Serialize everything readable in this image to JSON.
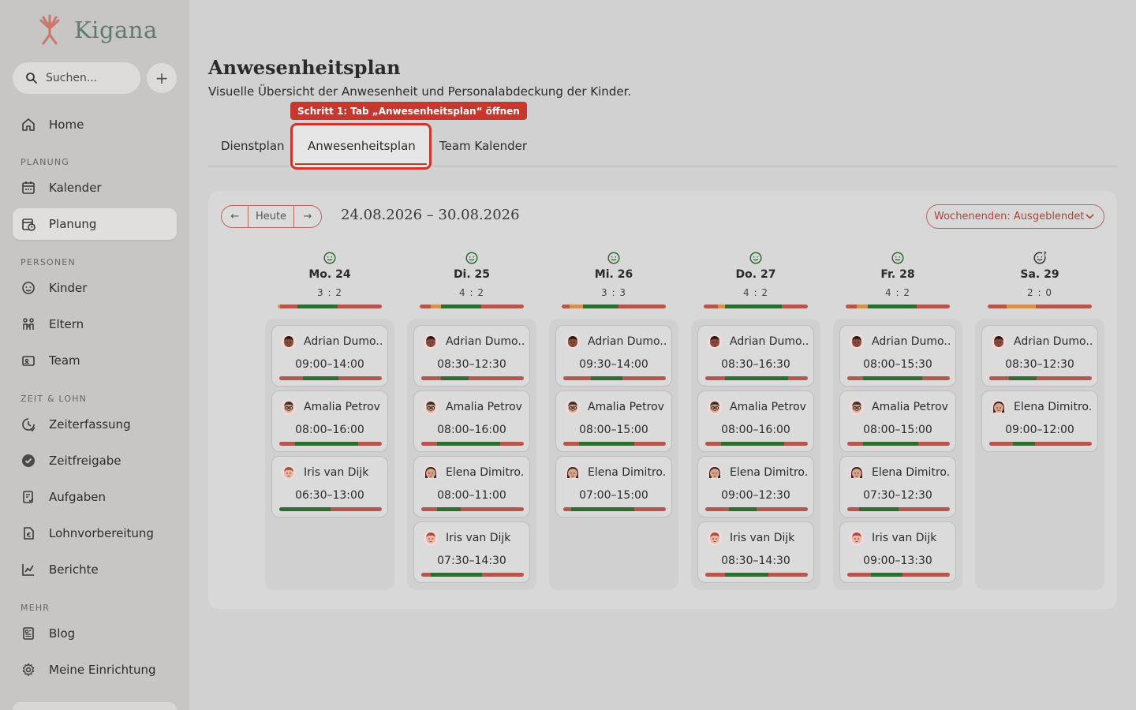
{
  "app": {
    "logo_text": "Kigana"
  },
  "search": {
    "placeholder": "Suchen..."
  },
  "sidebar": {
    "add_label": "+",
    "home": "Home",
    "sections": {
      "planung": "PLANUNG",
      "personen": "PERSONEN",
      "zeit": "ZEIT & LOHN",
      "mehr": "MEHR"
    },
    "items": {
      "kalender": "Kalender",
      "planung": "Planung",
      "kinder": "Kinder",
      "eltern": "Eltern",
      "team": "Team",
      "zeiterfassung": "Zeiterfassung",
      "zeitfreigabe": "Zeitfreigabe",
      "aufgaben": "Aufgaben",
      "lohnvorbereitung": "Lohnvorbereitung",
      "berichte": "Berichte",
      "blog": "Blog",
      "einrichtung": "Meine Einrichtung"
    },
    "active_item": "Planung"
  },
  "page": {
    "title": "Anwesenheitsplan",
    "subtitle": "Visuelle Übersicht der Anwesenheit und Personalabdeckung der Kinder.",
    "tooltip": "Schritt 1: Tab „Anwesenheitsplan“ öffnen",
    "tabs": [
      "Dienstplan",
      "Anwesenheitsplan",
      "Team Kalender"
    ],
    "active_tab": "Anwesenheitsplan"
  },
  "toolbar": {
    "prev": "←",
    "today": "Heute",
    "next": "→",
    "date_range": "24.08.2026 – 30.08.2026",
    "weekend_toggle": "Wochenenden: Ausgeblendet"
  },
  "colors": {
    "accent": "#a9453b",
    "good": "#2f6b32",
    "warn": "#d19455",
    "bad": "#b5574c"
  },
  "days": [
    {
      "name": "Mo. 24",
      "ratio": "3 : 2",
      "icon": "smile-icon",
      "bar": [
        [
          "o",
          3
        ],
        [
          "r",
          22
        ],
        [
          "g",
          51
        ],
        [
          "r",
          56
        ]
      ],
      "cards": [
        {
          "name": "Adrian Dumo...",
          "time": "09:00–14:00",
          "avatar": "boy-avatar",
          "bar": [
            [
              "r",
              30
            ],
            [
              "g",
              45
            ],
            [
              "r",
              55
            ]
          ]
        },
        {
          "name": "Amalia Petrov",
          "time": "08:00–16:00",
          "avatar": "glasses-avatar",
          "bar": [
            [
              "r",
              20
            ],
            [
              "g",
              80
            ],
            [
              "r",
              30
            ]
          ]
        },
        {
          "name": "Iris van Dijk",
          "time": "06:30–13:00",
          "avatar": "girl-avatar",
          "bar": [
            [
              "g",
              65
            ],
            [
              "r",
              65
            ]
          ]
        }
      ]
    },
    {
      "name": "Di. 25",
      "ratio": "4 : 2",
      "icon": "smile-icon",
      "bar": [
        [
          "r",
          14
        ],
        [
          "o",
          13
        ],
        [
          "g",
          51
        ],
        [
          "r",
          54
        ]
      ],
      "cards": [
        {
          "name": "Adrian Dumo...",
          "time": "08:30–12:30",
          "avatar": "boy-avatar",
          "bar": [
            [
              "r",
              25
            ],
            [
              "g",
              35
            ],
            [
              "r",
              70
            ]
          ]
        },
        {
          "name": "Amalia Petrov",
          "time": "08:00–16:00",
          "avatar": "glasses-avatar",
          "bar": [
            [
              "r",
              20
            ],
            [
              "g",
              80
            ],
            [
              "r",
              30
            ]
          ]
        },
        {
          "name": "Elena Dimitro...",
          "time": "08:00–11:00",
          "avatar": "woman-avatar",
          "bar": [
            [
              "r",
              20
            ],
            [
              "g",
              30
            ],
            [
              "r",
              80
            ]
          ]
        },
        {
          "name": "Iris van Dijk",
          "time": "07:30–14:30",
          "avatar": "girl-avatar",
          "bar": [
            [
              "r",
              12
            ],
            [
              "g",
              65
            ],
            [
              "r",
              53
            ]
          ]
        }
      ]
    },
    {
      "name": "Mi. 26",
      "ratio": "3 : 3",
      "icon": "smile-icon",
      "bar": [
        [
          "r",
          10
        ],
        [
          "o",
          17
        ],
        [
          "g",
          45
        ],
        [
          "r",
          60
        ]
      ],
      "cards": [
        {
          "name": "Adrian Dumo...",
          "time": "09:30–14:00",
          "avatar": "boy-avatar",
          "bar": [
            [
              "r",
              35
            ],
            [
              "g",
              40
            ],
            [
              "r",
              55
            ]
          ]
        },
        {
          "name": "Amalia Petrov",
          "time": "08:00–15:00",
          "avatar": "glasses-avatar",
          "bar": [
            [
              "r",
              20
            ],
            [
              "g",
              70
            ],
            [
              "r",
              40
            ]
          ]
        },
        {
          "name": "Elena Dimitro...",
          "time": "07:00–15:00",
          "avatar": "woman-avatar",
          "bar": [
            [
              "r",
              10
            ],
            [
              "g",
              80
            ],
            [
              "r",
              40
            ]
          ]
        }
      ]
    },
    {
      "name": "Do. 27",
      "ratio": "4 : 2",
      "icon": "smile-icon",
      "bar": [
        [
          "r",
          18
        ],
        [
          "o",
          9
        ],
        [
          "g",
          72
        ],
        [
          "r",
          33
        ]
      ],
      "cards": [
        {
          "name": "Adrian Dumo...",
          "time": "08:30–16:30",
          "avatar": "boy-avatar",
          "bar": [
            [
              "r",
              25
            ],
            [
              "g",
              80
            ],
            [
              "r",
              25
            ]
          ]
        },
        {
          "name": "Amalia Petrov",
          "time": "08:00–16:00",
          "avatar": "glasses-avatar",
          "bar": [
            [
              "r",
              20
            ],
            [
              "g",
              80
            ],
            [
              "r",
              30
            ]
          ]
        },
        {
          "name": "Elena Dimitro...",
          "time": "09:00–12:30",
          "avatar": "woman-avatar",
          "bar": [
            [
              "r",
              30
            ],
            [
              "g",
              35
            ],
            [
              "r",
              65
            ]
          ]
        },
        {
          "name": "Iris van Dijk",
          "time": "08:30–14:30",
          "avatar": "girl-avatar",
          "bar": [
            [
              "r",
              25
            ],
            [
              "g",
              55
            ],
            [
              "r",
              50
            ]
          ]
        }
      ]
    },
    {
      "name": "Fr. 28",
      "ratio": "4 : 2",
      "icon": "smile-icon",
      "bar": [
        [
          "r",
          14
        ],
        [
          "o",
          14
        ],
        [
          "g",
          62
        ],
        [
          "r",
          42
        ]
      ],
      "cards": [
        {
          "name": "Adrian Dumo...",
          "time": "08:00–15:30",
          "avatar": "boy-avatar",
          "bar": [
            [
              "r",
              20
            ],
            [
              "g",
              75
            ],
            [
              "r",
              35
            ]
          ]
        },
        {
          "name": "Amalia Petrov",
          "time": "08:00–15:00",
          "avatar": "glasses-avatar",
          "bar": [
            [
              "r",
              20
            ],
            [
              "g",
              70
            ],
            [
              "r",
              40
            ]
          ]
        },
        {
          "name": "Elena Dimitro...",
          "time": "07:30–12:30",
          "avatar": "woman-avatar",
          "bar": [
            [
              "r",
              15
            ],
            [
              "g",
              50
            ],
            [
              "r",
              65
            ]
          ]
        },
        {
          "name": "Iris van Dijk",
          "time": "09:00–13:30",
          "avatar": "girl-avatar",
          "bar": [
            [
              "r",
              30
            ],
            [
              "g",
              40
            ],
            [
              "r",
              60
            ]
          ]
        }
      ]
    },
    {
      "name": "Sa. 29",
      "ratio": "2 : 0",
      "icon": "smile-alert-icon",
      "bar": [
        [
          "r",
          24
        ],
        [
          "o",
          37
        ],
        [
          "r",
          71
        ]
      ],
      "cards": [
        {
          "name": "Adrian Dumo...",
          "time": "08:30–12:30",
          "avatar": "boy-avatar",
          "bar": [
            [
              "r",
              25
            ],
            [
              "g",
              35
            ],
            [
              "r",
              70
            ]
          ]
        },
        {
          "name": "Elena Dimitro...",
          "time": "09:00–12:00",
          "avatar": "woman-avatar",
          "bar": [
            [
              "r",
              30
            ],
            [
              "g",
              28
            ],
            [
              "r",
              72
            ]
          ]
        }
      ]
    }
  ]
}
